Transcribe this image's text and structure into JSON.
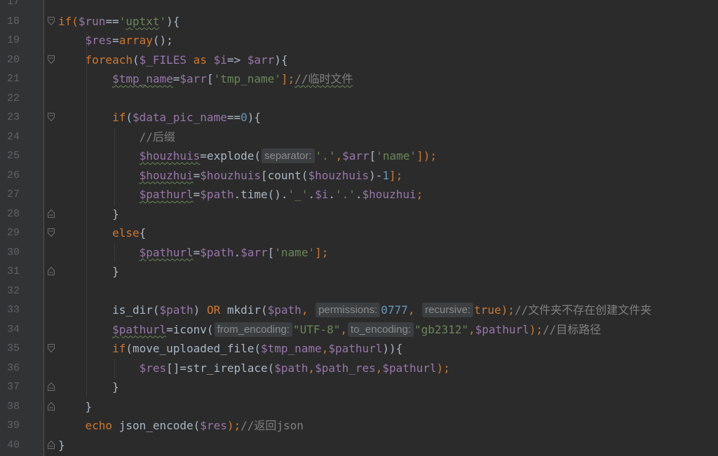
{
  "editor": {
    "colors": {
      "background": "#2b2b2b",
      "gutter": "#313335",
      "line_number": "#606366",
      "keyword": "#cc7832",
      "variable": "#9876aa",
      "string": "#6a8759",
      "number": "#6897bb",
      "comment": "#808080",
      "default": "#a9b7c6",
      "hint_bg": "#3b3f41",
      "hint_fg": "#8c8c8c"
    },
    "lines": [
      {
        "num": "17",
        "fold": "none",
        "tokens": []
      },
      {
        "num": "18",
        "fold": "open",
        "tokens": [
          {
            "t": "if(",
            "c": "kw"
          },
          {
            "t": "$run",
            "c": "var"
          },
          {
            "t": "==",
            "c": "txt"
          },
          {
            "t": "'",
            "c": "str"
          },
          {
            "t": "uptxt",
            "c": "str",
            "u": true
          },
          {
            "t": "'",
            "c": "str"
          },
          {
            "t": "){",
            "c": "txt"
          }
        ]
      },
      {
        "num": "19",
        "fold": "none",
        "tokens": [
          {
            "t": "    ",
            "c": "txt"
          },
          {
            "t": "$res",
            "c": "var"
          },
          {
            "t": "=",
            "c": "txt"
          },
          {
            "t": "array",
            "c": "kw"
          },
          {
            "t": "();",
            "c": "txt"
          }
        ]
      },
      {
        "num": "20",
        "fold": "open",
        "tokens": [
          {
            "t": "    ",
            "c": "txt"
          },
          {
            "t": "foreach",
            "c": "kw"
          },
          {
            "t": "(",
            "c": "txt"
          },
          {
            "t": "$_FILES",
            "c": "var"
          },
          {
            "t": " as ",
            "c": "kw"
          },
          {
            "t": "$i",
            "c": "var"
          },
          {
            "t": "=> ",
            "c": "txt"
          },
          {
            "t": "$arr",
            "c": "var"
          },
          {
            "t": "){",
            "c": "txt"
          }
        ]
      },
      {
        "num": "21",
        "fold": "none",
        "tokens": [
          {
            "t": "        ",
            "c": "txt"
          },
          {
            "t": "$tmp_name",
            "c": "var",
            "u": true
          },
          {
            "t": "=",
            "c": "txt"
          },
          {
            "t": "$arr",
            "c": "var"
          },
          {
            "t": "[",
            "c": "txt"
          },
          {
            "t": "'tmp_name'",
            "c": "str"
          },
          {
            "t": "];",
            "c": "kw"
          },
          {
            "t": "//临时文件",
            "c": "com",
            "u": true
          }
        ]
      },
      {
        "num": "22",
        "fold": "none",
        "tokens": []
      },
      {
        "num": "23",
        "fold": "open",
        "tokens": [
          {
            "t": "        ",
            "c": "txt"
          },
          {
            "t": "if",
            "c": "kw"
          },
          {
            "t": "(",
            "c": "txt"
          },
          {
            "t": "$data_pic_name",
            "c": "var"
          },
          {
            "t": "==",
            "c": "txt"
          },
          {
            "t": "0",
            "c": "num"
          },
          {
            "t": "){",
            "c": "txt"
          }
        ]
      },
      {
        "num": "24",
        "fold": "none",
        "tokens": [
          {
            "t": "            ",
            "c": "txt"
          },
          {
            "t": "//后缀",
            "c": "com"
          }
        ]
      },
      {
        "num": "25",
        "fold": "none",
        "tokens": [
          {
            "t": "            ",
            "c": "txt"
          },
          {
            "t": "$houzhuis",
            "c": "var",
            "u": true
          },
          {
            "t": "=explode(",
            "c": "txt"
          },
          {
            "t": "separator:",
            "c": "hint"
          },
          {
            "t": "'.'",
            "c": "str"
          },
          {
            "t": ",",
            "c": "kw"
          },
          {
            "t": "$arr",
            "c": "var"
          },
          {
            "t": "[",
            "c": "txt"
          },
          {
            "t": "'name'",
            "c": "str"
          },
          {
            "t": "]);",
            "c": "kw"
          }
        ]
      },
      {
        "num": "26",
        "fold": "none",
        "tokens": [
          {
            "t": "            ",
            "c": "txt"
          },
          {
            "t": "$houzhui",
            "c": "var",
            "u": true
          },
          {
            "t": "=",
            "c": "txt"
          },
          {
            "t": "$houzhuis",
            "c": "var"
          },
          {
            "t": "[count(",
            "c": "txt"
          },
          {
            "t": "$houzhuis",
            "c": "var"
          },
          {
            "t": ")-",
            "c": "txt"
          },
          {
            "t": "1",
            "c": "num"
          },
          {
            "t": "];",
            "c": "kw"
          }
        ]
      },
      {
        "num": "27",
        "fold": "none",
        "tokens": [
          {
            "t": "            ",
            "c": "txt"
          },
          {
            "t": "$pathurl",
            "c": "var",
            "u": true
          },
          {
            "t": "=",
            "c": "txt"
          },
          {
            "t": "$path",
            "c": "var"
          },
          {
            "t": ".time().",
            "c": "txt"
          },
          {
            "t": "'_'",
            "c": "str"
          },
          {
            "t": ".",
            "c": "txt"
          },
          {
            "t": "$i",
            "c": "var"
          },
          {
            "t": ".",
            "c": "txt"
          },
          {
            "t": "'.'",
            "c": "str"
          },
          {
            "t": ".",
            "c": "txt"
          },
          {
            "t": "$houzhui",
            "c": "var"
          },
          {
            "t": ";",
            "c": "kw"
          }
        ]
      },
      {
        "num": "28",
        "fold": "close",
        "tokens": [
          {
            "t": "        }",
            "c": "txt"
          }
        ]
      },
      {
        "num": "29",
        "fold": "open",
        "tokens": [
          {
            "t": "        ",
            "c": "txt"
          },
          {
            "t": "else",
            "c": "kw"
          },
          {
            "t": "{",
            "c": "txt"
          }
        ]
      },
      {
        "num": "30",
        "fold": "none",
        "tokens": [
          {
            "t": "            ",
            "c": "txt"
          },
          {
            "t": "$pathurl",
            "c": "var",
            "u": true
          },
          {
            "t": "=",
            "c": "txt"
          },
          {
            "t": "$path",
            "c": "var"
          },
          {
            "t": ".",
            "c": "txt"
          },
          {
            "t": "$arr",
            "c": "var"
          },
          {
            "t": "[",
            "c": "txt"
          },
          {
            "t": "'name'",
            "c": "str"
          },
          {
            "t": "];",
            "c": "kw"
          }
        ]
      },
      {
        "num": "31",
        "fold": "close",
        "tokens": [
          {
            "t": "        }",
            "c": "txt"
          }
        ]
      },
      {
        "num": "32",
        "fold": "none",
        "tokens": []
      },
      {
        "num": "33",
        "fold": "none",
        "tokens": [
          {
            "t": "        ",
            "c": "txt"
          },
          {
            "t": "is_dir(",
            "c": "txt"
          },
          {
            "t": "$path",
            "c": "var"
          },
          {
            "t": ") ",
            "c": "txt"
          },
          {
            "t": "OR",
            "c": "kw"
          },
          {
            "t": " mkdir(",
            "c": "txt"
          },
          {
            "t": "$path",
            "c": "var"
          },
          {
            "t": ", ",
            "c": "kw"
          },
          {
            "t": "permissions:",
            "c": "hint"
          },
          {
            "t": "0777",
            "c": "num"
          },
          {
            "t": ", ",
            "c": "kw"
          },
          {
            "t": "recursive:",
            "c": "hint"
          },
          {
            "t": "true",
            "c": "kw"
          },
          {
            "t": ");",
            "c": "kw"
          },
          {
            "t": "//文件夹不存在创建文件夹",
            "c": "com"
          }
        ]
      },
      {
        "num": "34",
        "fold": "none",
        "tokens": [
          {
            "t": "        ",
            "c": "txt"
          },
          {
            "t": "$pathurl",
            "c": "var",
            "u": true
          },
          {
            "t": "=iconv(",
            "c": "txt"
          },
          {
            "t": "from_encoding:",
            "c": "hint"
          },
          {
            "t": "\"UTF-8\"",
            "c": "str"
          },
          {
            "t": ",",
            "c": "kw"
          },
          {
            "t": "to_encoding:",
            "c": "hint"
          },
          {
            "t": "\"gb2312\"",
            "c": "str"
          },
          {
            "t": ",",
            "c": "kw"
          },
          {
            "t": "$pathurl",
            "c": "var"
          },
          {
            "t": ");",
            "c": "kw"
          },
          {
            "t": "//目标路径",
            "c": "com"
          }
        ]
      },
      {
        "num": "35",
        "fold": "open",
        "tokens": [
          {
            "t": "        ",
            "c": "txt"
          },
          {
            "t": "if",
            "c": "kw"
          },
          {
            "t": "(move_uploaded_file(",
            "c": "txt"
          },
          {
            "t": "$tmp_name",
            "c": "var"
          },
          {
            "t": ",",
            "c": "kw"
          },
          {
            "t": "$pathurl",
            "c": "var"
          },
          {
            "t": ")){",
            "c": "txt"
          }
        ]
      },
      {
        "num": "36",
        "fold": "none",
        "tokens": [
          {
            "t": "            ",
            "c": "txt"
          },
          {
            "t": "$res",
            "c": "var"
          },
          {
            "t": "[]=str_ireplace(",
            "c": "txt"
          },
          {
            "t": "$path",
            "c": "var"
          },
          {
            "t": ",",
            "c": "kw"
          },
          {
            "t": "$path_res",
            "c": "var"
          },
          {
            "t": ",",
            "c": "kw"
          },
          {
            "t": "$pathurl",
            "c": "var"
          },
          {
            "t": ");",
            "c": "kw"
          }
        ]
      },
      {
        "num": "37",
        "fold": "close",
        "tokens": [
          {
            "t": "        }",
            "c": "txt"
          }
        ]
      },
      {
        "num": "38",
        "fold": "close",
        "tokens": [
          {
            "t": "    }",
            "c": "txt"
          }
        ]
      },
      {
        "num": "39",
        "fold": "none",
        "tokens": [
          {
            "t": "    ",
            "c": "txt"
          },
          {
            "t": "echo",
            "c": "kw"
          },
          {
            "t": " json_encode(",
            "c": "txt"
          },
          {
            "t": "$res",
            "c": "var"
          },
          {
            "t": ");",
            "c": "kw"
          },
          {
            "t": "//返回json",
            "c": "com"
          }
        ]
      },
      {
        "num": "40",
        "fold": "close",
        "tokens": [
          {
            "t": "}",
            "c": "txt"
          }
        ]
      }
    ]
  }
}
